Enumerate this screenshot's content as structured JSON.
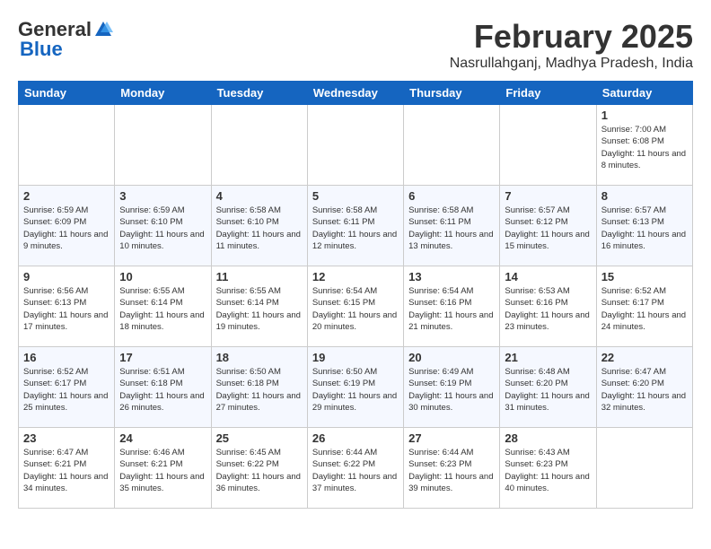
{
  "header": {
    "logo_general": "General",
    "logo_blue": "Blue",
    "month_title": "February 2025",
    "location": "Nasrullahganj, Madhya Pradesh, India"
  },
  "days_of_week": [
    "Sunday",
    "Monday",
    "Tuesday",
    "Wednesday",
    "Thursday",
    "Friday",
    "Saturday"
  ],
  "weeks": [
    [
      {
        "day": "",
        "sunrise": "",
        "sunset": "",
        "daylight": ""
      },
      {
        "day": "",
        "sunrise": "",
        "sunset": "",
        "daylight": ""
      },
      {
        "day": "",
        "sunrise": "",
        "sunset": "",
        "daylight": ""
      },
      {
        "day": "",
        "sunrise": "",
        "sunset": "",
        "daylight": ""
      },
      {
        "day": "",
        "sunrise": "",
        "sunset": "",
        "daylight": ""
      },
      {
        "day": "",
        "sunrise": "",
        "sunset": "",
        "daylight": ""
      },
      {
        "day": "1",
        "sunrise": "Sunrise: 7:00 AM",
        "sunset": "Sunset: 6:08 PM",
        "daylight": "Daylight: 11 hours and 8 minutes."
      }
    ],
    [
      {
        "day": "2",
        "sunrise": "Sunrise: 6:59 AM",
        "sunset": "Sunset: 6:09 PM",
        "daylight": "Daylight: 11 hours and 9 minutes."
      },
      {
        "day": "3",
        "sunrise": "Sunrise: 6:59 AM",
        "sunset": "Sunset: 6:10 PM",
        "daylight": "Daylight: 11 hours and 10 minutes."
      },
      {
        "day": "4",
        "sunrise": "Sunrise: 6:58 AM",
        "sunset": "Sunset: 6:10 PM",
        "daylight": "Daylight: 11 hours and 11 minutes."
      },
      {
        "day": "5",
        "sunrise": "Sunrise: 6:58 AM",
        "sunset": "Sunset: 6:11 PM",
        "daylight": "Daylight: 11 hours and 12 minutes."
      },
      {
        "day": "6",
        "sunrise": "Sunrise: 6:58 AM",
        "sunset": "Sunset: 6:11 PM",
        "daylight": "Daylight: 11 hours and 13 minutes."
      },
      {
        "day": "7",
        "sunrise": "Sunrise: 6:57 AM",
        "sunset": "Sunset: 6:12 PM",
        "daylight": "Daylight: 11 hours and 15 minutes."
      },
      {
        "day": "8",
        "sunrise": "Sunrise: 6:57 AM",
        "sunset": "Sunset: 6:13 PM",
        "daylight": "Daylight: 11 hours and 16 minutes."
      }
    ],
    [
      {
        "day": "9",
        "sunrise": "Sunrise: 6:56 AM",
        "sunset": "Sunset: 6:13 PM",
        "daylight": "Daylight: 11 hours and 17 minutes."
      },
      {
        "day": "10",
        "sunrise": "Sunrise: 6:55 AM",
        "sunset": "Sunset: 6:14 PM",
        "daylight": "Daylight: 11 hours and 18 minutes."
      },
      {
        "day": "11",
        "sunrise": "Sunrise: 6:55 AM",
        "sunset": "Sunset: 6:14 PM",
        "daylight": "Daylight: 11 hours and 19 minutes."
      },
      {
        "day": "12",
        "sunrise": "Sunrise: 6:54 AM",
        "sunset": "Sunset: 6:15 PM",
        "daylight": "Daylight: 11 hours and 20 minutes."
      },
      {
        "day": "13",
        "sunrise": "Sunrise: 6:54 AM",
        "sunset": "Sunset: 6:16 PM",
        "daylight": "Daylight: 11 hours and 21 minutes."
      },
      {
        "day": "14",
        "sunrise": "Sunrise: 6:53 AM",
        "sunset": "Sunset: 6:16 PM",
        "daylight": "Daylight: 11 hours and 23 minutes."
      },
      {
        "day": "15",
        "sunrise": "Sunrise: 6:52 AM",
        "sunset": "Sunset: 6:17 PM",
        "daylight": "Daylight: 11 hours and 24 minutes."
      }
    ],
    [
      {
        "day": "16",
        "sunrise": "Sunrise: 6:52 AM",
        "sunset": "Sunset: 6:17 PM",
        "daylight": "Daylight: 11 hours and 25 minutes."
      },
      {
        "day": "17",
        "sunrise": "Sunrise: 6:51 AM",
        "sunset": "Sunset: 6:18 PM",
        "daylight": "Daylight: 11 hours and 26 minutes."
      },
      {
        "day": "18",
        "sunrise": "Sunrise: 6:50 AM",
        "sunset": "Sunset: 6:18 PM",
        "daylight": "Daylight: 11 hours and 27 minutes."
      },
      {
        "day": "19",
        "sunrise": "Sunrise: 6:50 AM",
        "sunset": "Sunset: 6:19 PM",
        "daylight": "Daylight: 11 hours and 29 minutes."
      },
      {
        "day": "20",
        "sunrise": "Sunrise: 6:49 AM",
        "sunset": "Sunset: 6:19 PM",
        "daylight": "Daylight: 11 hours and 30 minutes."
      },
      {
        "day": "21",
        "sunrise": "Sunrise: 6:48 AM",
        "sunset": "Sunset: 6:20 PM",
        "daylight": "Daylight: 11 hours and 31 minutes."
      },
      {
        "day": "22",
        "sunrise": "Sunrise: 6:47 AM",
        "sunset": "Sunset: 6:20 PM",
        "daylight": "Daylight: 11 hours and 32 minutes."
      }
    ],
    [
      {
        "day": "23",
        "sunrise": "Sunrise: 6:47 AM",
        "sunset": "Sunset: 6:21 PM",
        "daylight": "Daylight: 11 hours and 34 minutes."
      },
      {
        "day": "24",
        "sunrise": "Sunrise: 6:46 AM",
        "sunset": "Sunset: 6:21 PM",
        "daylight": "Daylight: 11 hours and 35 minutes."
      },
      {
        "day": "25",
        "sunrise": "Sunrise: 6:45 AM",
        "sunset": "Sunset: 6:22 PM",
        "daylight": "Daylight: 11 hours and 36 minutes."
      },
      {
        "day": "26",
        "sunrise": "Sunrise: 6:44 AM",
        "sunset": "Sunset: 6:22 PM",
        "daylight": "Daylight: 11 hours and 37 minutes."
      },
      {
        "day": "27",
        "sunrise": "Sunrise: 6:44 AM",
        "sunset": "Sunset: 6:23 PM",
        "daylight": "Daylight: 11 hours and 39 minutes."
      },
      {
        "day": "28",
        "sunrise": "Sunrise: 6:43 AM",
        "sunset": "Sunset: 6:23 PM",
        "daylight": "Daylight: 11 hours and 40 minutes."
      },
      {
        "day": "",
        "sunrise": "",
        "sunset": "",
        "daylight": ""
      }
    ]
  ]
}
